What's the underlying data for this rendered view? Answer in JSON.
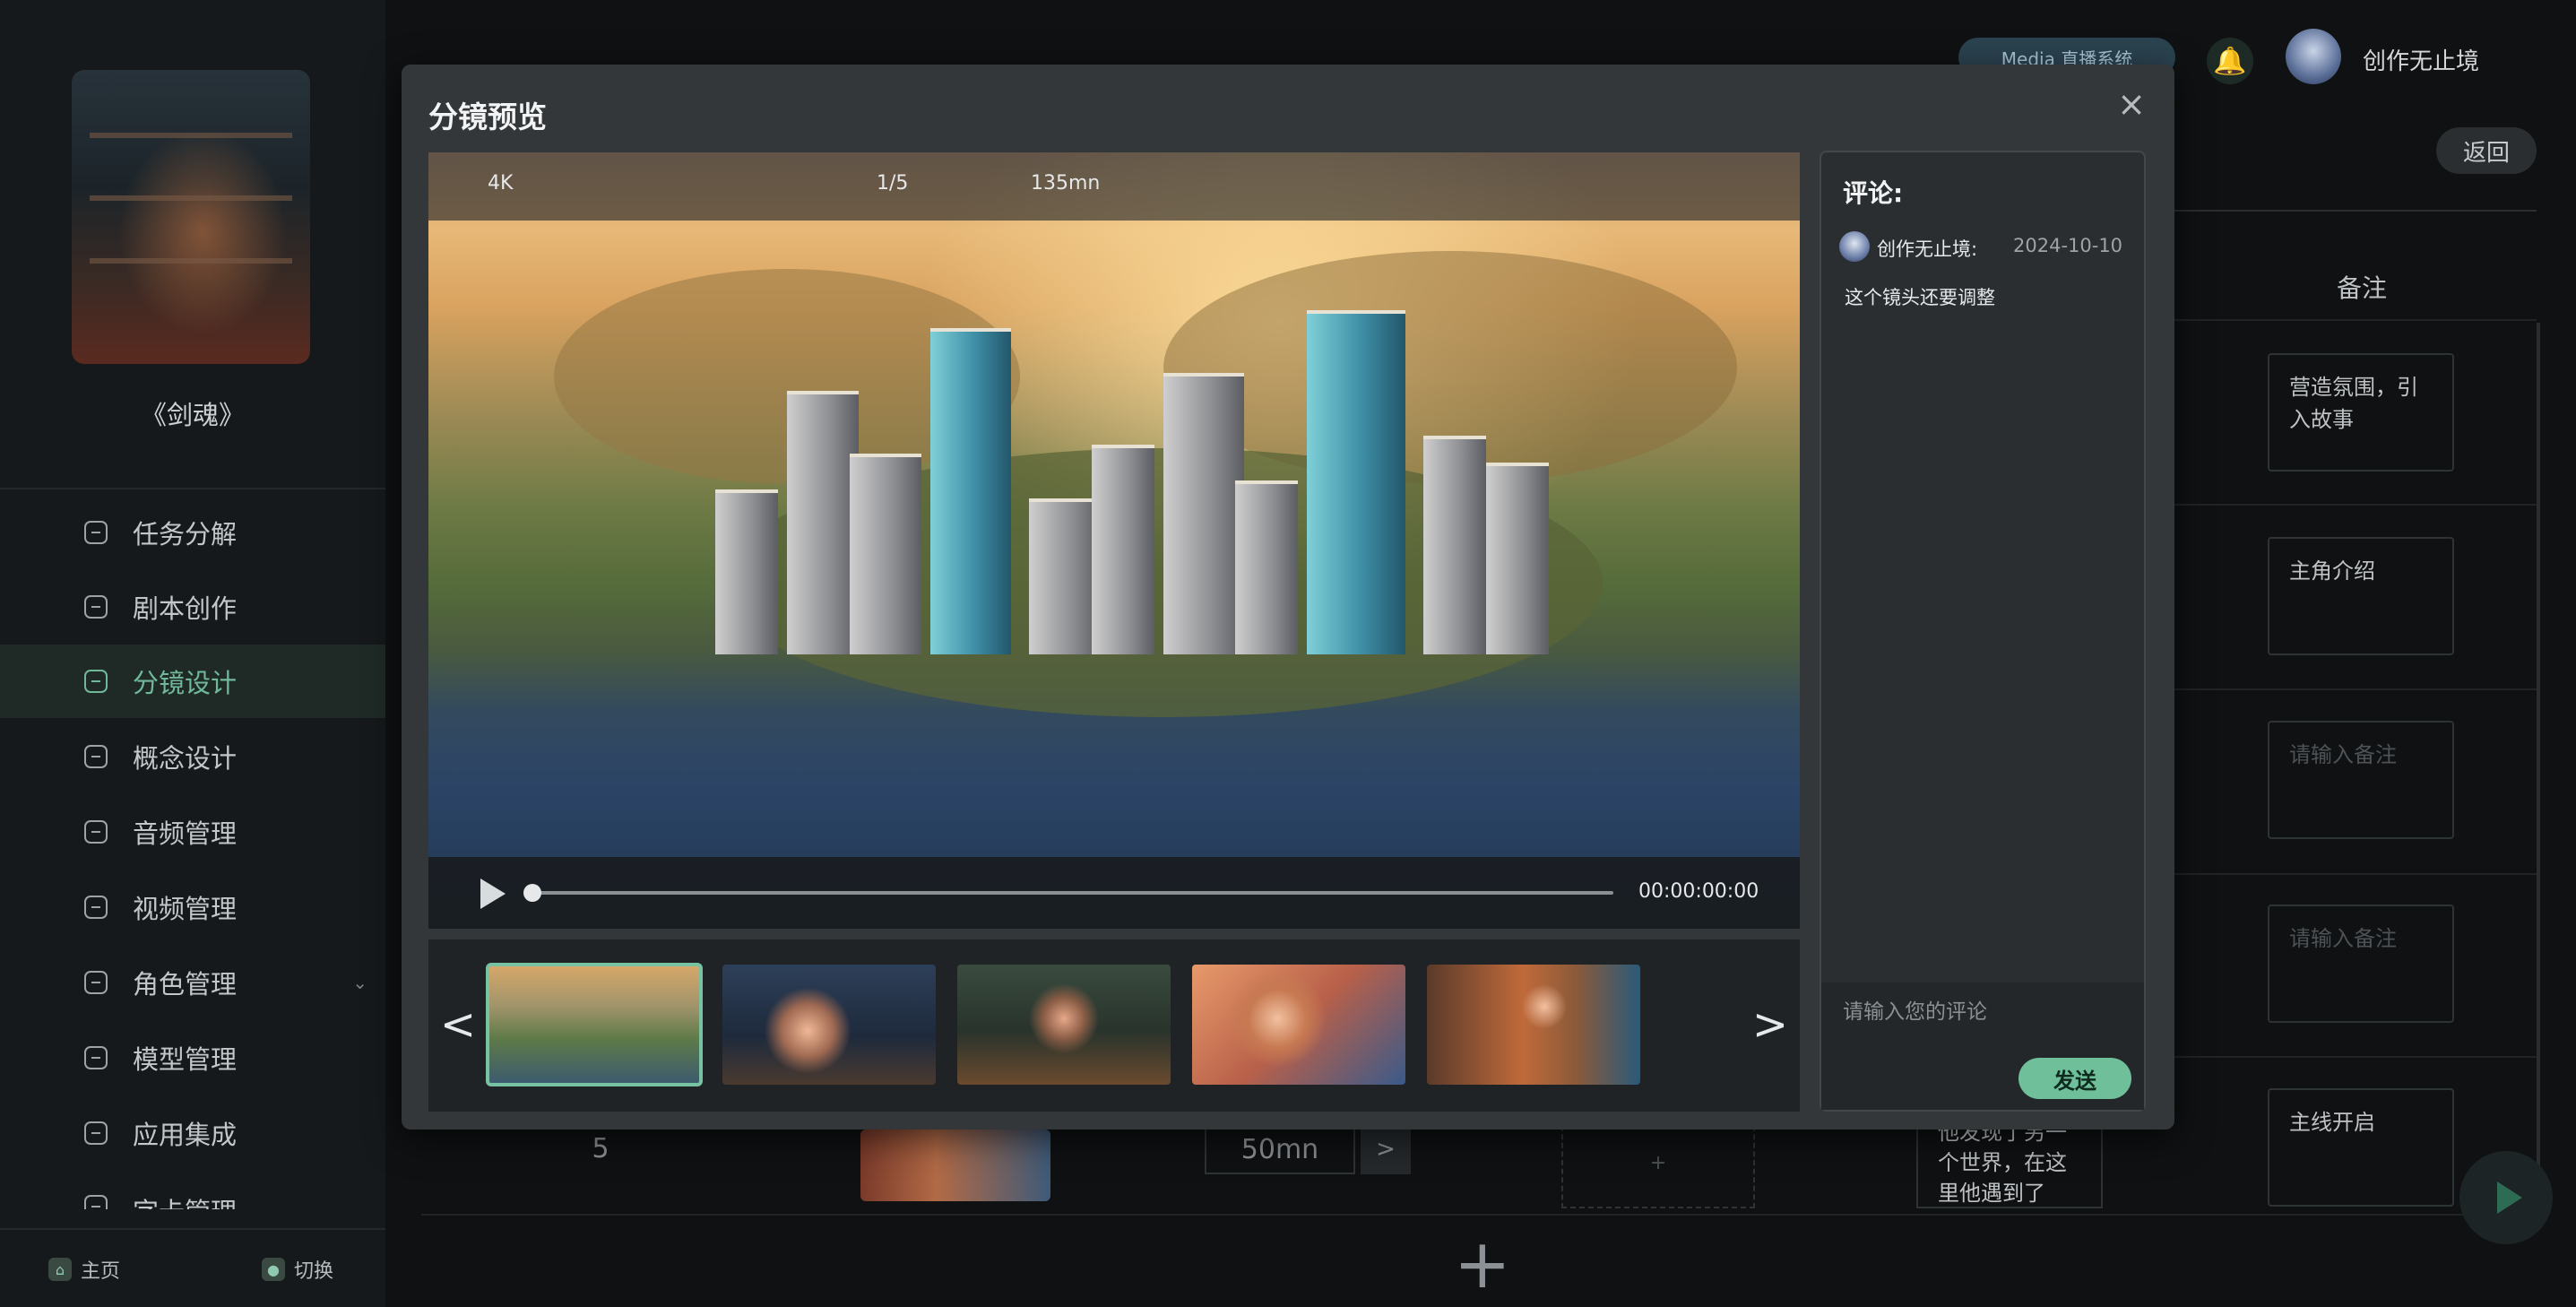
{
  "sidebar": {
    "book_title": "《剑魂》",
    "items": [
      {
        "label": "任务分解",
        "icon": "task-icon"
      },
      {
        "label": "剧本创作",
        "icon": "script-icon"
      },
      {
        "label": "分镜设计",
        "icon": "storyboard-icon",
        "active": true
      },
      {
        "label": "概念设计",
        "icon": "concept-icon"
      },
      {
        "label": "音频管理",
        "icon": "audio-icon"
      },
      {
        "label": "视频管理",
        "icon": "video-icon"
      },
      {
        "label": "角色管理",
        "icon": "character-icon",
        "has_submenu": true
      },
      {
        "label": "模型管理",
        "icon": "model-icon"
      },
      {
        "label": "应用集成",
        "icon": "apps-icon"
      },
      {
        "label": "字卡管理",
        "icon": "card-icon"
      }
    ],
    "bottom": {
      "home_label": "主页",
      "switch_label": "切换"
    }
  },
  "header": {
    "media_label": "Media 直播系统",
    "username": "创作无止境",
    "back_label": "返回"
  },
  "table": {
    "notes_header": "备注",
    "notes": [
      "营造氛围，引入故事",
      "主角介绍",
      "",
      "",
      "主线开启"
    ],
    "note_placeholder": "请输入备注",
    "row5": {
      "number": "5",
      "duration": "50mn",
      "next_label": ">",
      "add_label": "+",
      "script_text": "他发现了另一个世界，在这里他遇到了"
    },
    "add_row_label": "+"
  },
  "modal": {
    "title": "分镜预览",
    "close_label": "×",
    "viewer": {
      "resolution": "4K",
      "page_indicator": "1/5",
      "duration": "135mn",
      "time": "00:00:00:00",
      "progress": 0
    },
    "thumbnails": [
      {
        "name": "thumb-city",
        "selected": true
      },
      {
        "name": "thumb-boy-workshop"
      },
      {
        "name": "thumb-boy-desk"
      },
      {
        "name": "thumb-boy-frame"
      },
      {
        "name": "thumb-boy-friends"
      }
    ],
    "prev_label": "<",
    "next_label": ">",
    "comments": {
      "title": "评论:",
      "entries": [
        {
          "user": "创作无止境:",
          "date": "2024-10-10",
          "text": "这个镜头还要调整"
        }
      ],
      "input_placeholder": "请输入您的评论",
      "send_label": "发送"
    }
  },
  "colors": {
    "accent": "#6fbf9a",
    "background": "#0f1112",
    "modal": "#33373a"
  }
}
